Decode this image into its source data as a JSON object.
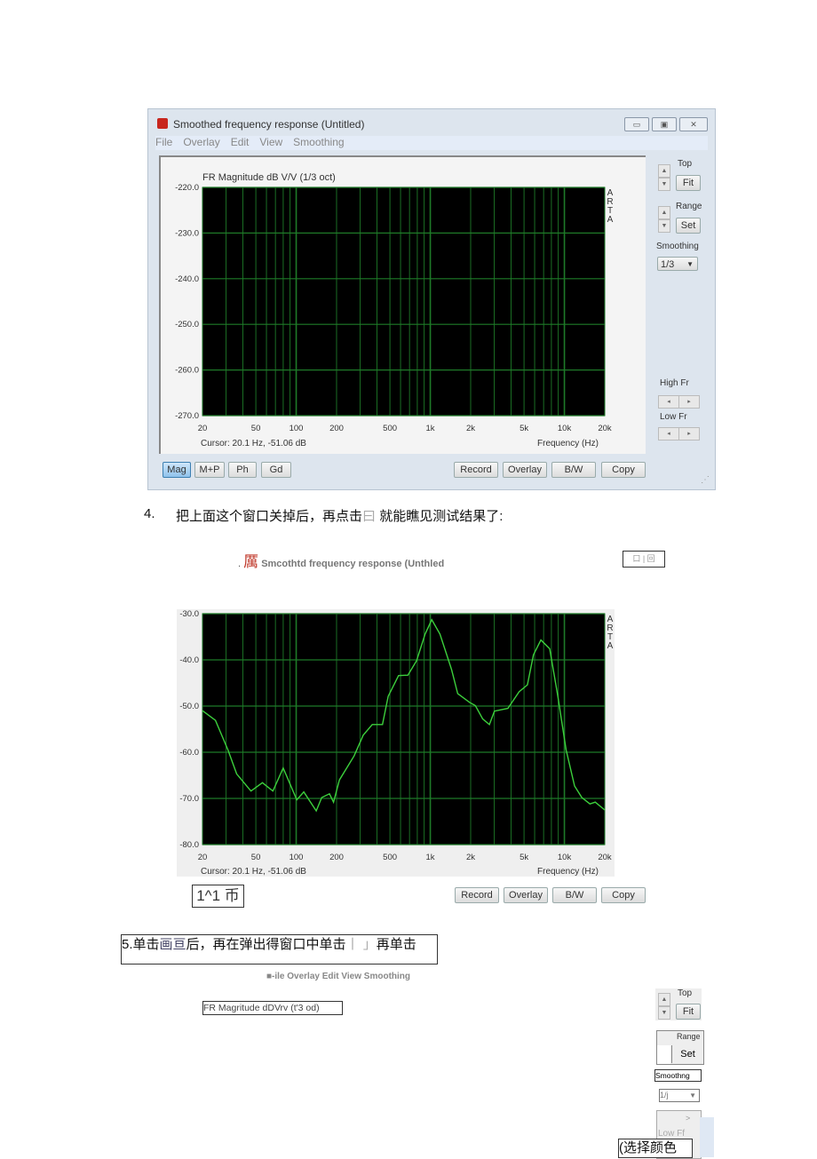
{
  "window1": {
    "title": "Smoothed frequency response (Untitled)",
    "controls": [
      "▭",
      "▣",
      "✕"
    ],
    "menu": [
      "File",
      "Overlay",
      "Edit",
      "View",
      "Smoothing"
    ],
    "side": {
      "top": "Top",
      "fit": "Fit",
      "range": "Range",
      "set": "Set",
      "smoothing": "Smoothing",
      "smoothing_value": "1/3",
      "high_fr": "High Fr",
      "low_fr": "Low Fr"
    },
    "cursor": "Cursor: 20.1 Hz, -51.06 dB",
    "tabs": [
      "Mag",
      "M+P",
      "Ph",
      "Gd"
    ],
    "buttons": [
      "Record",
      "Overlay",
      "B/W",
      "Copy"
    ]
  },
  "step4": {
    "number": "4.",
    "text": "把上面这个窗口关掉后，再点击",
    "icon_glyph": "曰",
    "text2": " 就能瞧见测试结果了:"
  },
  "window2": {
    "title_prefix": ".",
    "title_glyph": "厲",
    "title": "Smcothtd frequency response (Unthled",
    "controls": "口 | 回",
    "cursor": "Cursor: 20.1 Hz, -51.06 dB",
    "buttons": [
      "Record",
      "Overlay",
      "B/W",
      "Copy"
    ],
    "tab_box": "1^1 币"
  },
  "step5": {
    "text": "5.单击",
    "glyph": "画亘",
    "text2": "后，再在弹出得窗口中单击",
    "glyph2": "丨 」",
    "text3": "再单击"
  },
  "window3": {
    "menu": "■-ile Overlay Edit View Smoothing",
    "chart_title": "FR Magritude dDVrv (t'3 od)",
    "top": "Top",
    "fit": "Fit",
    "range": "Range",
    "set": "Set",
    "smoothing": "Smoothng",
    "smoothing_value": "1/j",
    "arrow": ">",
    "low_fr": "Low Ff",
    "caption": "(选择颜色"
  },
  "colors": {
    "plot_bg": "#000000",
    "grid": "#1e7a28",
    "curve": "#3ccf3c",
    "active_tab": "#9cc8ee"
  },
  "chart_data": [
    {
      "type": "line",
      "title": "FR Magnitude dB V/V (1/3 oct)",
      "xlabel": "Frequency (Hz)",
      "ylabel": "",
      "side_label": "ARTA",
      "xscale": "log",
      "xlim": [
        20,
        20000
      ],
      "ylim": [
        -270,
        -220
      ],
      "yticks": [
        "-220.0",
        "-230.0",
        "-240.0",
        "-250.0",
        "-260.0",
        "-270.0"
      ],
      "xticks": [
        {
          "v": 20,
          "t": "20"
        },
        {
          "v": 50,
          "t": "50"
        },
        {
          "v": 100,
          "t": "100"
        },
        {
          "v": 200,
          "t": "200"
        },
        {
          "v": 500,
          "t": "500"
        },
        {
          "v": 1000,
          "t": "1k"
        },
        {
          "v": 2000,
          "t": "2k"
        },
        {
          "v": 5000,
          "t": "5k"
        },
        {
          "v": 10000,
          "t": "10k"
        },
        {
          "v": 20000,
          "t": "20k"
        }
      ],
      "grid": true,
      "series": []
    },
    {
      "type": "line",
      "title": "",
      "xlabel": "Frequency (Hz)",
      "ylabel": "",
      "side_label": "ARTA",
      "xscale": "log",
      "xlim": [
        20,
        20000
      ],
      "ylim": [
        -80,
        -30
      ],
      "yticks": [
        "-30.0",
        "-40.0",
        "-50.0",
        "-60.0",
        "-70.0",
        "-80.0"
      ],
      "xticks": [
        {
          "v": 20,
          "t": "20"
        },
        {
          "v": 50,
          "t": "50"
        },
        {
          "v": 100,
          "t": "100"
        },
        {
          "v": 200,
          "t": "200"
        },
        {
          "v": 500,
          "t": "500"
        },
        {
          "v": 1000,
          "t": "1k"
        },
        {
          "v": 2000,
          "t": "2k"
        },
        {
          "v": 5000,
          "t": "5k"
        },
        {
          "v": 10000,
          "t": "10k"
        },
        {
          "v": 20000,
          "t": "20k"
        }
      ],
      "grid": true,
      "series": [
        {
          "x": [
            20,
            25,
            31,
            36,
            46,
            56,
            67,
            80,
            101,
            114,
            141,
            155,
            177,
            190,
            210,
            270,
            316,
            369,
            440,
            485,
            580,
            680,
            790,
            915,
            1025,
            1180,
            1440,
            1600,
            1960,
            2170,
            2460,
            2760,
            3010,
            3790,
            4600,
            5300,
            5880,
            6680,
            7770,
            8940,
            10300,
            11900,
            13500,
            15500,
            17000,
            20000
          ],
          "y": [
            -51,
            -53.1,
            -59.5,
            -64.7,
            -68.4,
            -66.6,
            -68.4,
            -63.4,
            -70.3,
            -68.6,
            -72.7,
            -69.8,
            -69,
            -70.8,
            -66,
            -60.8,
            -56.3,
            -54,
            -54,
            -47.9,
            -43.4,
            -43.3,
            -40.2,
            -34.4,
            -31.3,
            -34.4,
            -42.1,
            -47.3,
            -49.2,
            -49.9,
            -52.8,
            -54,
            -51.1,
            -50.5,
            -46.9,
            -45.4,
            -38.9,
            -35.7,
            -37.6,
            -47.9,
            -59.5,
            -67.3,
            -69.8,
            -71.2,
            -70.8,
            -72.5
          ]
        }
      ]
    }
  ]
}
